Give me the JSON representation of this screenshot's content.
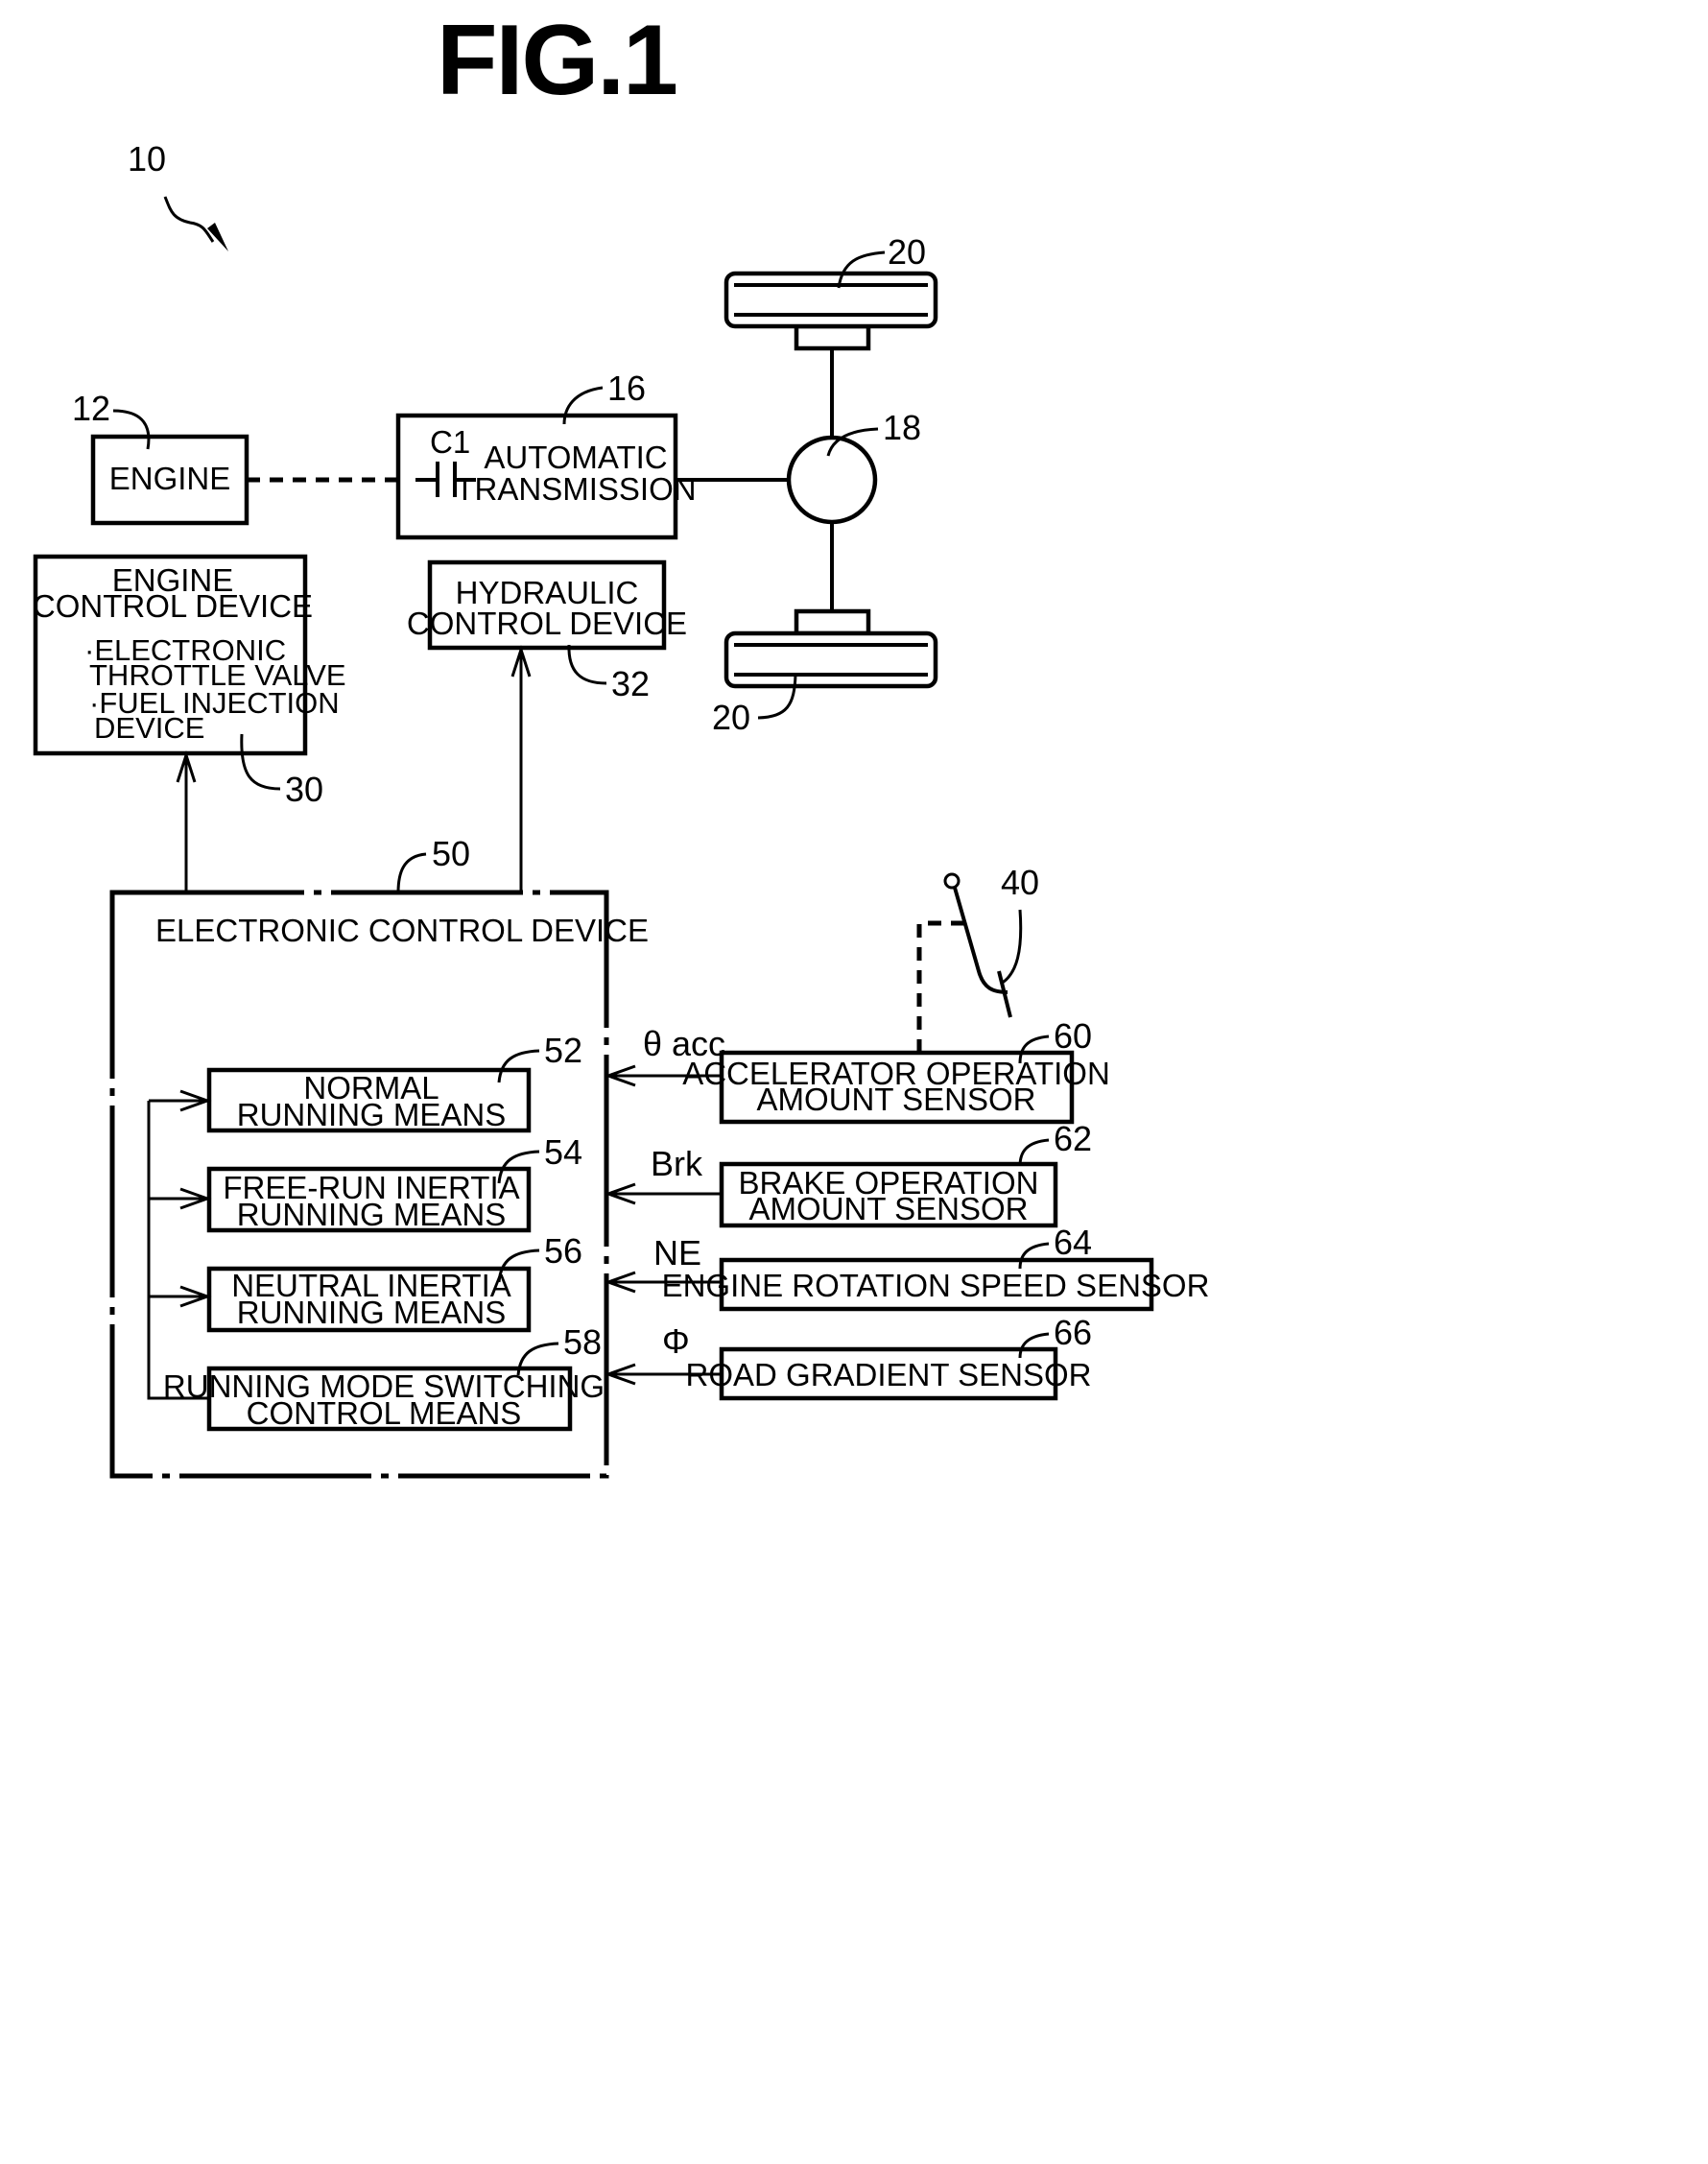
{
  "figure": {
    "title": "FIG.1",
    "system_ref": "10"
  },
  "powertrain": {
    "engine": {
      "ref": "12",
      "label": "ENGINE"
    },
    "transmission": {
      "ref": "16",
      "lines": [
        "AUTOMATIC",
        "TRANSMISSION"
      ],
      "clutch_label": "C1"
    },
    "differential": {
      "ref": "18"
    },
    "wheels": {
      "ref_top": "20",
      "ref_bottom": "20"
    }
  },
  "control_devices": {
    "engine_control": {
      "ref": "30",
      "title_lines": [
        "ENGINE",
        "CONTROL DEVICE"
      ],
      "items": [
        [
          "·ELECTRONIC",
          "THROTTLE VALVE"
        ],
        [
          "·FUEL INJECTION",
          "DEVICE"
        ]
      ]
    },
    "hydraulic_control": {
      "ref": "32",
      "lines": [
        "HYDRAULIC",
        "CONTROL DEVICE"
      ]
    }
  },
  "electronic_control_device": {
    "ref": "50",
    "title": "ELECTRONIC CONTROL DEVICE",
    "means": [
      {
        "ref": "52",
        "lines": [
          "NORMAL",
          "RUNNING MEANS"
        ]
      },
      {
        "ref": "54",
        "lines": [
          "FREE-RUN INERTIA",
          "RUNNING MEANS"
        ]
      },
      {
        "ref": "56",
        "lines": [
          "NEUTRAL INERTIA",
          "RUNNING MEANS"
        ]
      },
      {
        "ref": "58",
        "lines": [
          "RUNNING MODE SWITCHING",
          "CONTROL MEANS"
        ]
      }
    ]
  },
  "accelerator_pedal": {
    "ref": "40"
  },
  "sensors": [
    {
      "ref": "60",
      "signal": "θ acc",
      "lines": [
        "ACCELERATOR OPERATION",
        "AMOUNT SENSOR"
      ]
    },
    {
      "ref": "62",
      "signal": "Brk",
      "lines": [
        "BRAKE OPERATION",
        "AMOUNT SENSOR"
      ]
    },
    {
      "ref": "64",
      "signal": "NE",
      "lines": [
        "ENGINE ROTATION SPEED SENSOR"
      ]
    },
    {
      "ref": "66",
      "signal": "Φ",
      "lines": [
        "ROAD GRADIENT SENSOR"
      ]
    }
  ]
}
